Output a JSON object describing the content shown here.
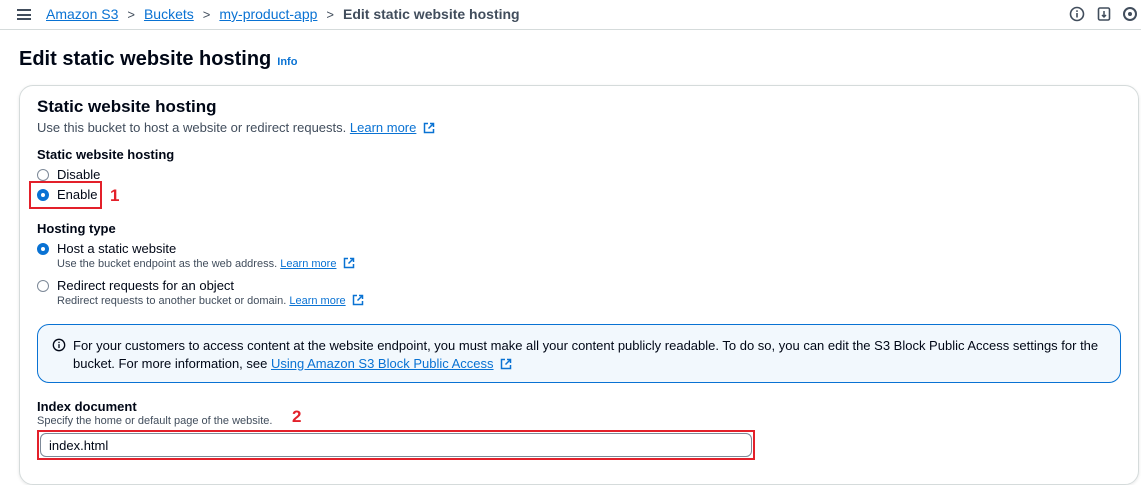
{
  "breadcrumb": {
    "items": [
      "Amazon S3",
      "Buckets",
      "my-product-app"
    ],
    "current": "Edit static website hosting",
    "separator": ">"
  },
  "page": {
    "title": "Edit static website hosting",
    "info_label": "Info"
  },
  "section": {
    "title": "Static website hosting",
    "description": "Use this bucket to host a website or redirect requests.",
    "learn_more": "Learn more"
  },
  "hosting": {
    "label": "Static website hosting",
    "options": [
      "Disable",
      "Enable"
    ],
    "selected": "Enable"
  },
  "hosting_type": {
    "label": "Hosting type",
    "options": [
      {
        "label": "Host a static website",
        "description": "Use the bucket endpoint as the web address.",
        "link": "Learn more"
      },
      {
        "label": "Redirect requests for an object",
        "description": "Redirect requests to another bucket or domain.",
        "link": "Learn more"
      }
    ],
    "selected": "Host a static website"
  },
  "alert": {
    "text": "For your customers to access content at the website endpoint, you must make all your content publicly readable. To do so, you can edit the S3 Block Public Access settings for the bucket. For more information, see",
    "link": "Using Amazon S3 Block Public Access"
  },
  "index_document": {
    "label": "Index document",
    "description": "Specify the home or default page of the website.",
    "value": "index.html"
  },
  "annotations": {
    "marker_1": "1",
    "marker_2": "2"
  },
  "colors": {
    "accent": "#0972d3",
    "annotation": "#e3202a",
    "text": "#000716"
  },
  "icons": [
    "menu-icon",
    "info-circle-icon",
    "notifications-icon",
    "settings-icon",
    "external-link-icon"
  ]
}
